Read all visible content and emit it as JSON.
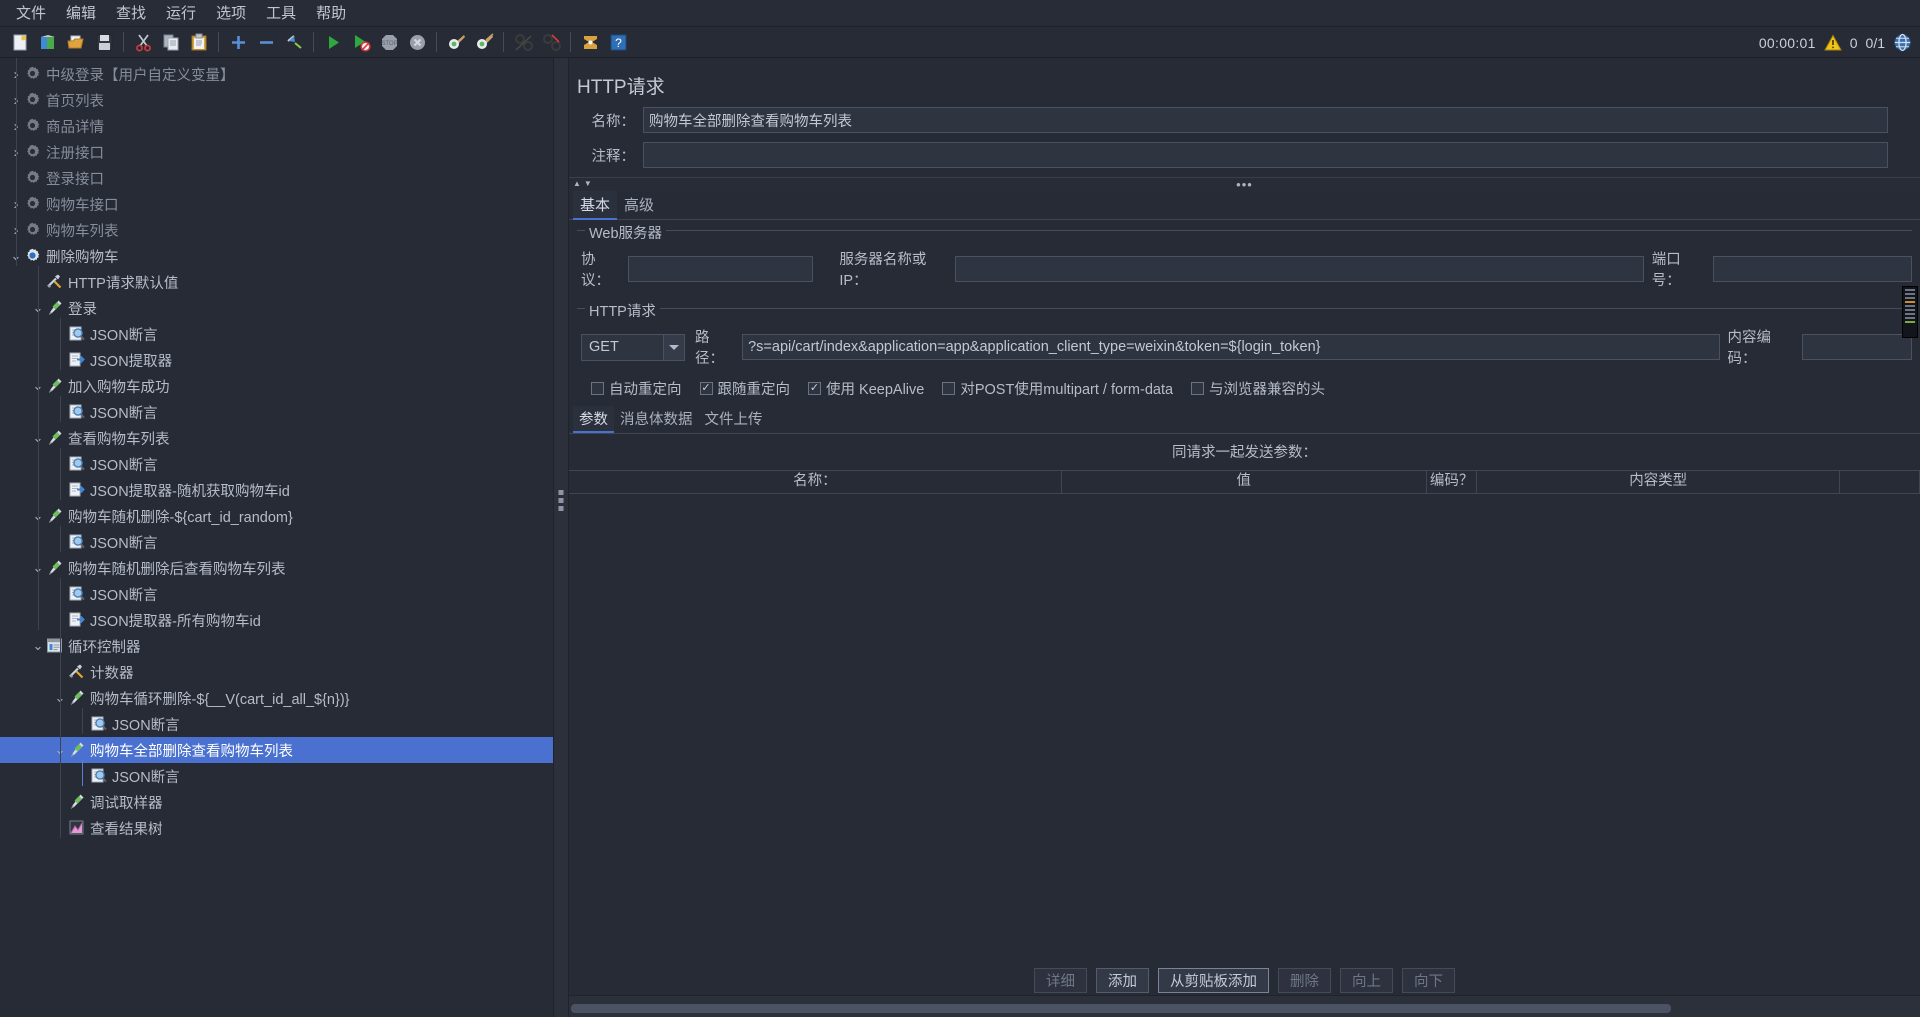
{
  "menubar": {
    "items": [
      {
        "label": "文件",
        "name": "menu-file"
      },
      {
        "label": "编辑",
        "name": "menu-edit"
      },
      {
        "label": "查找",
        "name": "menu-search"
      },
      {
        "label": "运行",
        "name": "menu-run"
      },
      {
        "label": "选项",
        "name": "menu-options"
      },
      {
        "label": "工具",
        "name": "menu-tools"
      },
      {
        "label": "帮助",
        "name": "menu-help"
      }
    ]
  },
  "toolbar": {
    "icons": [
      "new-file-icon",
      "open-template-icon",
      "open-folder-icon",
      "save-icon",
      "cut-icon",
      "copy-icon",
      "paste-icon",
      "expand-all-icon",
      "collapse-all-icon",
      "toggle-icon",
      "start-icon",
      "start-no-timers-icon",
      "stop-icon",
      "shutdown-icon",
      "clear-icon",
      "clear-all-icon",
      "search-icon",
      "search-reset-icon",
      "function-helper-icon",
      "help-icon"
    ],
    "timer": "00:00:01",
    "warning_icon": "warning-triangle-icon",
    "warning_count": "0",
    "threads": "0/1",
    "remote_icon": "sphere-icon"
  },
  "tree": {
    "items": [
      {
        "label": "中级登录【用户自定义变量】",
        "depth": 0,
        "arrow": "right",
        "icon": "gear-icon",
        "dim": true
      },
      {
        "label": "首页列表",
        "depth": 0,
        "arrow": "right",
        "icon": "gear-icon",
        "dim": true
      },
      {
        "label": "商品详情",
        "depth": 0,
        "arrow": "right",
        "icon": "gear-icon",
        "dim": true
      },
      {
        "label": "注册接口",
        "depth": 0,
        "arrow": "right",
        "icon": "gear-icon",
        "dim": true
      },
      {
        "label": "登录接口",
        "depth": 0,
        "arrow": "none",
        "icon": "gear-icon",
        "dim": true
      },
      {
        "label": "购物车接口",
        "depth": 0,
        "arrow": "right",
        "icon": "gear-icon",
        "dim": true
      },
      {
        "label": "购物车列表",
        "depth": 0,
        "arrow": "right",
        "icon": "gear-icon",
        "dim": true
      },
      {
        "label": "删除购物车",
        "depth": 0,
        "arrow": "down",
        "icon": "gear-blue-icon",
        "dim": false
      },
      {
        "label": "HTTP请求默认值",
        "depth": 1,
        "arrow": "none",
        "icon": "config-tools-icon",
        "dim": false
      },
      {
        "label": "登录",
        "depth": 1,
        "arrow": "down",
        "icon": "sampler-icon",
        "dim": false
      },
      {
        "label": "JSON断言",
        "depth": 2,
        "arrow": "none",
        "icon": "assertion-icon",
        "dim": false
      },
      {
        "label": "JSON提取器",
        "depth": 2,
        "arrow": "none",
        "icon": "extractor-icon",
        "dim": false
      },
      {
        "label": "加入购物车成功",
        "depth": 1,
        "arrow": "down",
        "icon": "sampler-icon",
        "dim": false
      },
      {
        "label": "JSON断言",
        "depth": 2,
        "arrow": "none",
        "icon": "assertion-icon",
        "dim": false
      },
      {
        "label": "查看购物车列表",
        "depth": 1,
        "arrow": "down",
        "icon": "sampler-icon",
        "dim": false
      },
      {
        "label": "JSON断言",
        "depth": 2,
        "arrow": "none",
        "icon": "assertion-icon",
        "dim": false
      },
      {
        "label": "JSON提取器-随机获取购物车id",
        "depth": 2,
        "arrow": "none",
        "icon": "extractor-icon",
        "dim": false
      },
      {
        "label": "购物车随机删除-${cart_id_random}",
        "depth": 1,
        "arrow": "down",
        "icon": "sampler-icon",
        "dim": false
      },
      {
        "label": "JSON断言",
        "depth": 2,
        "arrow": "none",
        "icon": "assertion-icon",
        "dim": false
      },
      {
        "label": "购物车随机删除后查看购物车列表",
        "depth": 1,
        "arrow": "down",
        "icon": "sampler-icon",
        "dim": false
      },
      {
        "label": "JSON断言",
        "depth": 2,
        "arrow": "none",
        "icon": "assertion-icon",
        "dim": false
      },
      {
        "label": "JSON提取器-所有购物车id",
        "depth": 2,
        "arrow": "none",
        "icon": "extractor-icon",
        "dim": false
      },
      {
        "label": "循环控制器",
        "depth": 1,
        "arrow": "down",
        "icon": "controller-icon",
        "dim": false
      },
      {
        "label": "计数器",
        "depth": 2,
        "arrow": "none",
        "icon": "config-tools-icon",
        "dim": false
      },
      {
        "label": "购物车循环删除-${__V(cart_id_all_${n})}",
        "depth": 2,
        "arrow": "down",
        "icon": "sampler-icon",
        "dim": false
      },
      {
        "label": "JSON断言",
        "depth": 3,
        "arrow": "none",
        "icon": "assertion-icon",
        "dim": false
      },
      {
        "label": "购物车全部删除查看购物车列表",
        "depth": 2,
        "arrow": "down",
        "icon": "sampler-icon",
        "dim": false,
        "selected": true
      },
      {
        "label": "JSON断言",
        "depth": 3,
        "arrow": "none",
        "icon": "assertion-icon",
        "dim": false
      },
      {
        "label": "调试取样器",
        "depth": 2,
        "arrow": "none",
        "icon": "sampler-icon",
        "dim": false
      },
      {
        "label": "查看结果树",
        "depth": 2,
        "arrow": "none",
        "icon": "listener-icon",
        "dim": false
      }
    ]
  },
  "panel": {
    "title": "HTTP请求",
    "name_label": "名称：",
    "name_value": "购物车全部删除查看购物车列表",
    "comment_label": "注释：",
    "comment_value": "",
    "tabs": [
      {
        "label": "基本",
        "active": true
      },
      {
        "label": "高级",
        "active": false
      }
    ],
    "webserver": {
      "group_title": "Web服务器",
      "protocol_label": "协议：",
      "protocol_value": "",
      "server_label": "服务器名称或IP：",
      "server_value": "",
      "port_label": "端口号：",
      "port_value": ""
    },
    "httprequest": {
      "group_title": "HTTP请求",
      "method": "GET",
      "path_label": "路径：",
      "path_value": "?s=api/cart/index&application=app&application_client_type=weixin&token=${login_token}",
      "encoding_label": "内容编码：",
      "encoding_value": "",
      "checkboxes": [
        {
          "label": "自动重定向",
          "checked": false
        },
        {
          "label": "跟随重定向",
          "checked": true
        },
        {
          "label": "使用 KeepAlive",
          "checked": true
        },
        {
          "label": "对POST使用multipart / form-data",
          "checked": false
        },
        {
          "label": "与浏览器兼容的头",
          "checked": false
        }
      ]
    },
    "param_tabs": [
      {
        "label": "参数",
        "active": true
      },
      {
        "label": "消息体数据",
        "active": false
      },
      {
        "label": "文件上传",
        "active": false
      }
    ],
    "send_with_request": "同请求一起发送参数：",
    "table": {
      "columns": [
        "名称：",
        "值",
        "编码？",
        "内容类型",
        ""
      ],
      "rows": []
    },
    "buttons": [
      {
        "label": "详细",
        "disabled": true,
        "strong": false
      },
      {
        "label": "添加",
        "disabled": false,
        "strong": false
      },
      {
        "label": "从剪贴板添加",
        "disabled": false,
        "strong": true
      },
      {
        "label": "删除",
        "disabled": true,
        "strong": false
      },
      {
        "label": "向上",
        "disabled": true,
        "strong": false
      },
      {
        "label": "向下",
        "disabled": true,
        "strong": false
      }
    ]
  },
  "colors": {
    "selection": "#4a71d0",
    "background": "#262b36",
    "text": "#b6bcc8",
    "accent": "#4a71d0"
  }
}
